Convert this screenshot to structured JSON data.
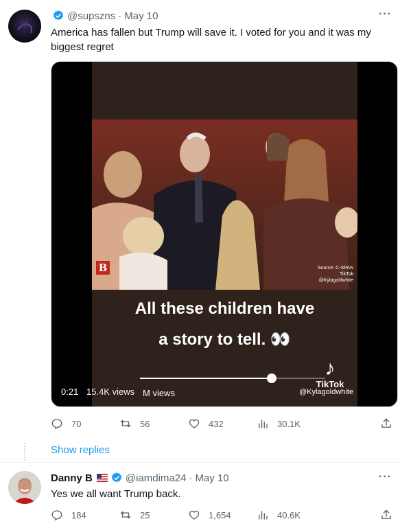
{
  "tweet1": {
    "handle": "@supszns",
    "dot": "·",
    "date": "May 10",
    "text": "America has fallen but Trump will save it. I voted for you and it was my biggest regret",
    "more": "···",
    "video": {
      "caption_line1": "All these children have",
      "caption_line2": "a story to tell. 👀",
      "b_badge": "B",
      "source_label": "Source: C-SPAN",
      "tiktok_small": "TikTok",
      "tiktok_small_handle": "@Kylagoldwhite",
      "tiktok_logo_word": "TikTok",
      "overlay_views": "M views",
      "overlay_handle": "@Kylagoldwhite",
      "time": "0:21",
      "views": "15.4K views",
      "progress_fraction": 0.71
    },
    "actions": {
      "reply_count": "70",
      "retweet_count": "56",
      "like_count": "432",
      "view_count": "30.1K"
    }
  },
  "show_replies": "Show replies",
  "tweet2": {
    "name": "Danny B",
    "handle": "@iamdima24",
    "dot": "·",
    "date": "May 10",
    "text": "Yes we all want Trump back.",
    "more": "···",
    "actions": {
      "reply_count": "184",
      "retweet_count": "25",
      "like_count": "1,654",
      "view_count": "40.6K"
    }
  },
  "colors": {
    "accent": "#1d9bf0",
    "muted": "#536471",
    "text": "#0f1419"
  },
  "icons": [
    "verified-badge-icon",
    "reply-icon",
    "retweet-icon",
    "like-icon",
    "views-icon",
    "share-icon",
    "more-icon",
    "us-flag-icon"
  ]
}
